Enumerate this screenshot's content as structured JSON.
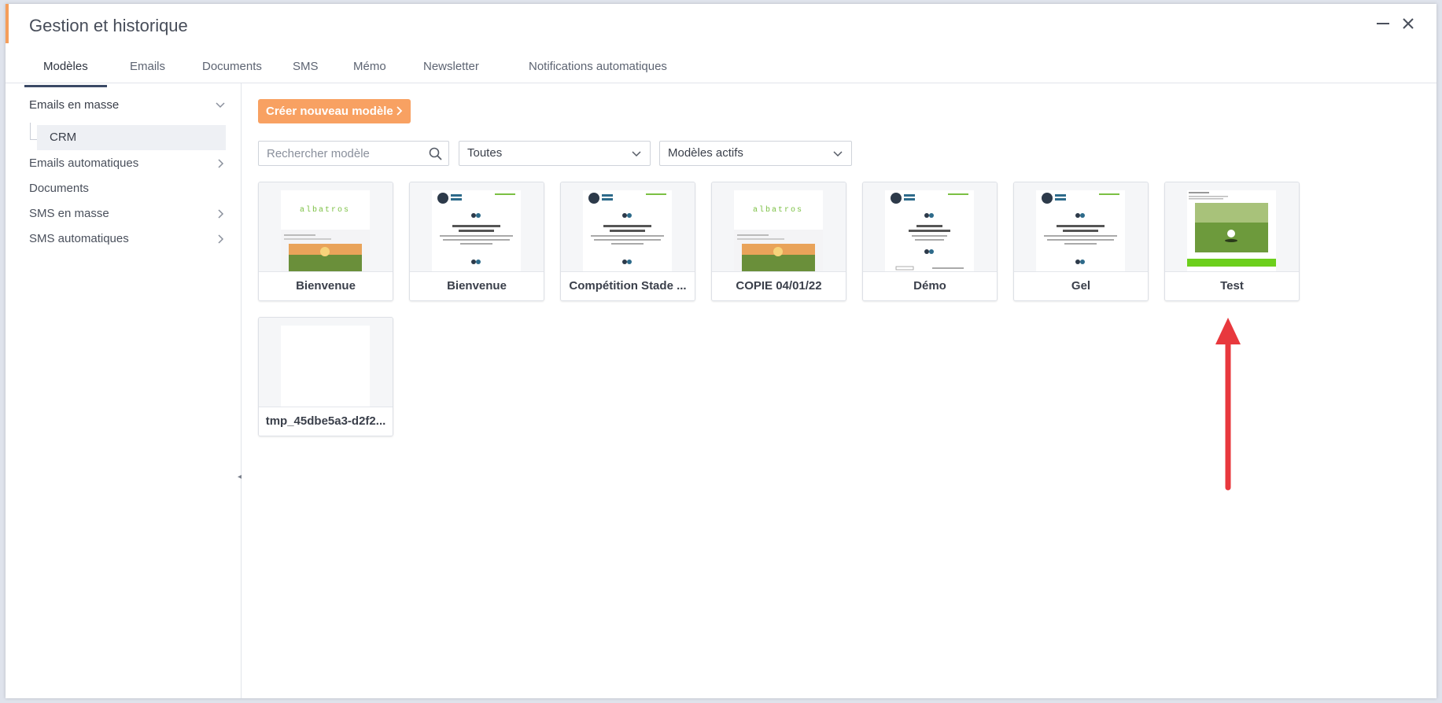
{
  "window": {
    "title": "Gestion et historique",
    "accent_color": "#f59e5b"
  },
  "tabs": [
    {
      "label": "Modèles",
      "active": true
    },
    {
      "label": "Emails"
    },
    {
      "label": "Documents"
    },
    {
      "label": "SMS"
    },
    {
      "label": "Mémo"
    },
    {
      "label": "Newsletter"
    },
    {
      "label": "Notifications automatiques"
    }
  ],
  "sidebar": {
    "items": [
      {
        "label": "Emails en masse",
        "expanded": true
      },
      {
        "label": "CRM",
        "selected": true
      },
      {
        "label": "Emails automatiques"
      },
      {
        "label": "Documents"
      },
      {
        "label": "SMS en masse"
      },
      {
        "label": "SMS automatiques"
      }
    ]
  },
  "toolbar": {
    "create_label": "Créer nouveau modèle",
    "create_color": "#f8a162",
    "search_placeholder": "Rechercher modèle",
    "filter1_value": "Toutes",
    "filter2_value": "Modèles actifs"
  },
  "templates": [
    {
      "name": "Bienvenue",
      "thumb": "albatros-banner"
    },
    {
      "name": "Bienvenue",
      "thumb": "welcome-letter"
    },
    {
      "name": "Compétition Stade ...",
      "thumb": "welcome-letter"
    },
    {
      "name": "COPIE 04/01/22",
      "thumb": "albatros-banner"
    },
    {
      "name": "Démo",
      "thumb": "demo-letter"
    },
    {
      "name": "Gel",
      "thumb": "welcome-letter"
    },
    {
      "name": "Test",
      "thumb": "golf-photo"
    },
    {
      "name": "tmp_45dbe5a3-d2f2...",
      "thumb": "blank"
    }
  ],
  "annotation": {
    "type": "arrow",
    "color": "#e8383d",
    "points_to": "Test"
  }
}
